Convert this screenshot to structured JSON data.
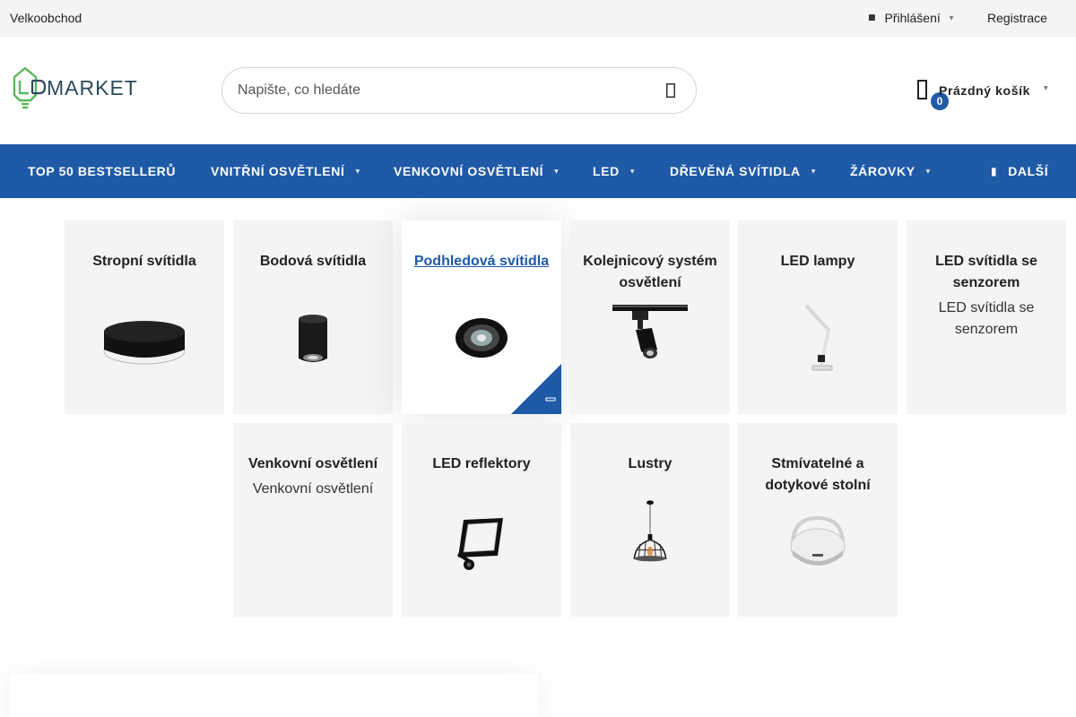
{
  "topbar": {
    "wholesale_label": "Velkoobchod",
    "login_label": "Přihlášení",
    "register_label": "Registrace"
  },
  "logo": {
    "text": "MARKET"
  },
  "search": {
    "placeholder": "Napište, co hledáte"
  },
  "cart": {
    "count": "0",
    "label": "Prázdný košík"
  },
  "nav": {
    "items": [
      {
        "label": "TOP 50 BESTSELLERŮ"
      },
      {
        "label": "VNITŘNÍ OSVĚTLENÍ"
      },
      {
        "label": "VENKOVNÍ OSVĚTLENÍ"
      },
      {
        "label": "LED"
      },
      {
        "label": "DŘEVĚNÁ SVÍTIDLA"
      },
      {
        "label": "ŽÁROVKY"
      }
    ],
    "more_label": "DALŠÍ"
  },
  "categories": [
    {
      "title": "Stropní svítidla",
      "icon": "ceiling-light-image"
    },
    {
      "title": "Bodová svítidla",
      "icon": "spot-light-image"
    },
    {
      "title": "Podhledová svítidla",
      "icon": "recessed-light-image"
    },
    {
      "title": "Kolejnicový systém osvětlení",
      "icon": "track-light-image"
    },
    {
      "title": "LED lampy",
      "icon": "desk-lamp-image"
    },
    {
      "title": "LED svítidla se senzorem",
      "alt": "LED svítidla se senzorem"
    },
    {
      "title": "Venkovní osvětlení",
      "alt": "Venkovní osvětlení"
    },
    {
      "title": "LED reflektory",
      "icon": "floodlight-image"
    },
    {
      "title": "Lustry",
      "icon": "chandelier-image"
    },
    {
      "title": "Stmívatelné a dotykové stolní",
      "icon": "table-lamp-image"
    }
  ],
  "colors": {
    "brand_blue": "#1f5aa6",
    "logo_green": "#5cb85c",
    "logo_dark": "#2c4a5a",
    "tile_bg": "#f4f4f4"
  }
}
